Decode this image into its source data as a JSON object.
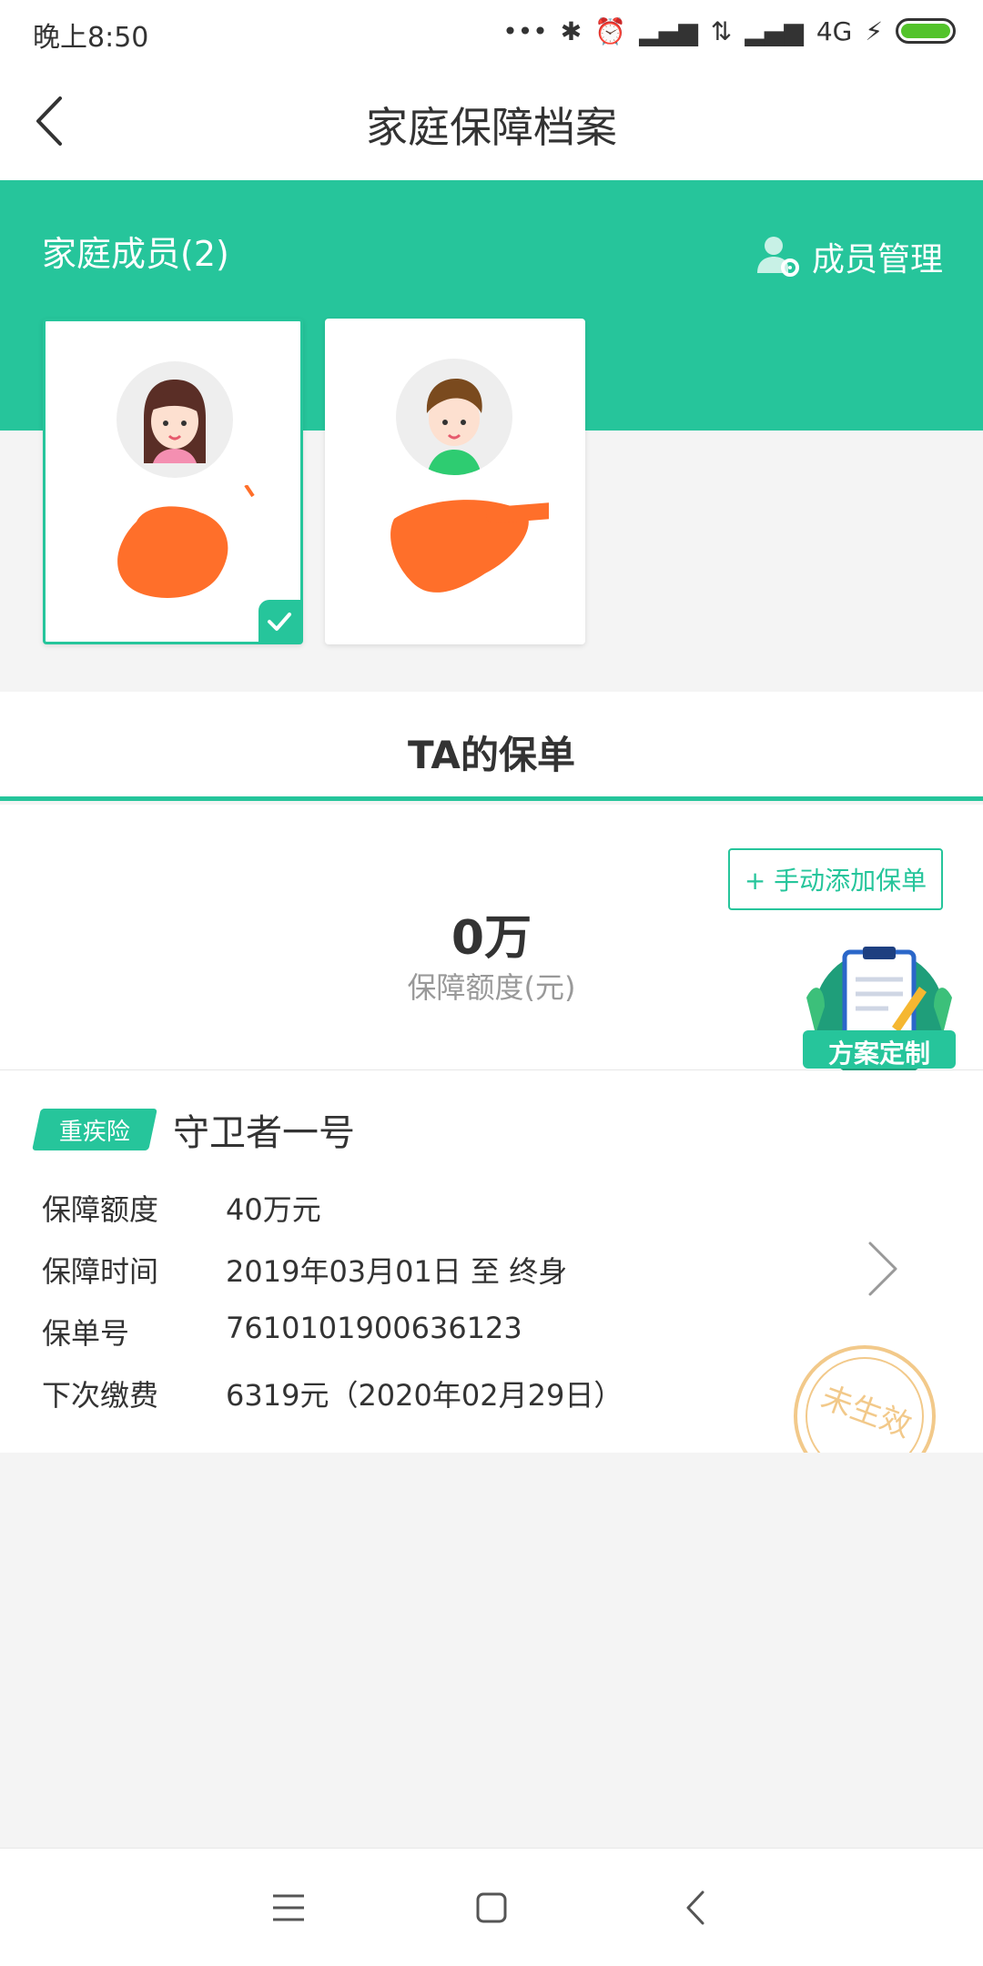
{
  "status_bar": {
    "time": "晚上8:50",
    "network": "4G",
    "icons": [
      "more-dots-icon",
      "bluetooth-icon",
      "alarm-icon",
      "signal-icon",
      "data-transfer-icon",
      "signal-icon",
      "charging-icon",
      "battery-icon"
    ]
  },
  "nav": {
    "title": "家庭保障档案",
    "back_icon": "chevron-left-icon"
  },
  "family": {
    "title": "家庭成员(2)",
    "manage_label": "成员管理",
    "members": [
      {
        "avatar": "female-avatar",
        "selected": true
      },
      {
        "avatar": "male-avatar",
        "selected": false
      }
    ]
  },
  "tab": {
    "label": "TA的保单"
  },
  "summary": {
    "add_button": "+ 手动添加保单",
    "amount": "0万",
    "amount_label": "保障额度(元)",
    "custom_plan_label": "方案定制"
  },
  "policy": {
    "tag": "重疾险",
    "name": "守卫者一号",
    "rows": [
      {
        "key": "保障额度",
        "value": "40万元"
      },
      {
        "key": "保障时间",
        "value": "2019年03月01日 至 终身"
      },
      {
        "key": "保单号",
        "value": "7610101900636123"
      },
      {
        "key": "下次缴费",
        "value": "6319元（2020年02月29日）"
      }
    ],
    "stamp_text": "未生效"
  },
  "colors": {
    "accent": "#26c59b",
    "background": "#f4f4f4",
    "redaction": "#ff6f2a",
    "stamp": "#f2c98a"
  },
  "bottom_nav": [
    "menu-icon",
    "home-square-icon",
    "back-icon"
  ]
}
